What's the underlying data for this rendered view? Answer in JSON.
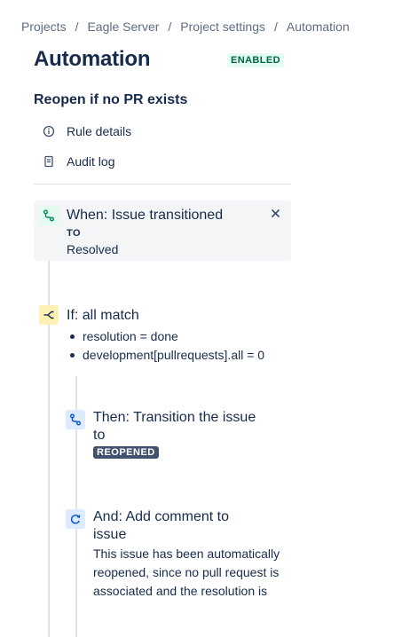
{
  "breadcrumb": {
    "items": [
      "Projects",
      "Eagle Server",
      "Project settings",
      "Automation"
    ],
    "separator": "/"
  },
  "header": {
    "title": "Automation",
    "status_badge": "ENABLED"
  },
  "rule": {
    "name": "Reopen if no PR exists",
    "menu": [
      {
        "label": "Rule details",
        "icon": "info-icon"
      },
      {
        "label": "Audit log",
        "icon": "document-icon"
      }
    ]
  },
  "trigger": {
    "title": "When: Issue transitioned",
    "to_label": "TO",
    "to_value": "Resolved",
    "icon": "transition-icon",
    "close_icon": "close-icon"
  },
  "condition": {
    "title": "If: all match",
    "icon": "branch-icon",
    "items": [
      "resolution = done",
      "development[pullrequests].all = 0"
    ]
  },
  "action_transition": {
    "title_line1": "Then: Transition the issue",
    "title_line2": "to",
    "status": "REOPENED",
    "icon": "transition-icon"
  },
  "action_comment": {
    "title_line1": "And: Add comment to",
    "title_line2": "issue",
    "text_line1": "This issue has been automatically",
    "text_line2": "reopened, since no pull request is",
    "text_line3": "associated and the resolution is",
    "icon": "refresh-icon"
  },
  "colors": {
    "enabled_bg": "#e3fcef",
    "enabled_text": "#006644",
    "trigger_icon_bg": "#e3fcef",
    "condition_icon_bg": "#fff0b3",
    "action_icon_bg": "#deebff",
    "reopened_bg": "#42526e"
  }
}
